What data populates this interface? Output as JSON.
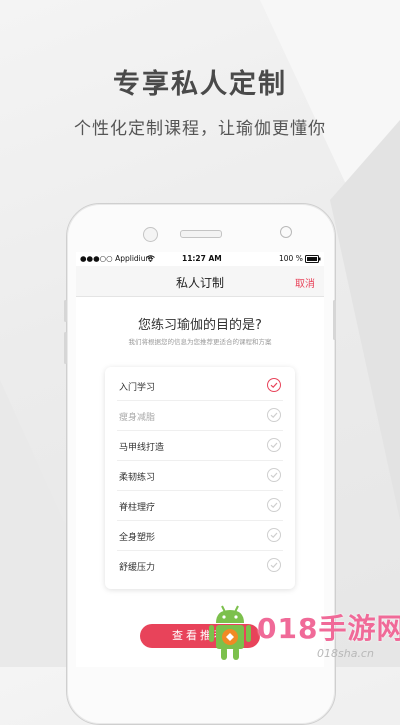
{
  "promo": {
    "headline": "专享私人定制",
    "subheadline": "个性化定制课程，让瑜伽更懂你"
  },
  "status_bar": {
    "carrier": "●●●○○ Applidium",
    "time": "11:27 AM",
    "battery": "100 %"
  },
  "navbar": {
    "title": "私人订制",
    "cancel_label": "取消"
  },
  "question": {
    "title": "您练习瑜伽的目的是?",
    "subtitle": "我们将根据您的信息为您推荐更适合的课程和方案"
  },
  "options": [
    {
      "label": "入门学习",
      "selected": true
    },
    {
      "label": "瘦身减脂",
      "selected": false
    },
    {
      "label": "马甲线打造",
      "selected": false
    },
    {
      "label": "柔韧练习",
      "selected": false
    },
    {
      "label": "脊柱理疗",
      "selected": false
    },
    {
      "label": "全身塑形",
      "selected": false
    },
    {
      "label": "舒缓压力",
      "selected": false
    }
  ],
  "cta": {
    "label": "查看推荐"
  },
  "watermark": {
    "text": "018手游网",
    "url": "018sha.cn"
  },
  "colors": {
    "accent": "#e8435a",
    "watermark": "#f06a98",
    "android": "#7cc04c"
  }
}
